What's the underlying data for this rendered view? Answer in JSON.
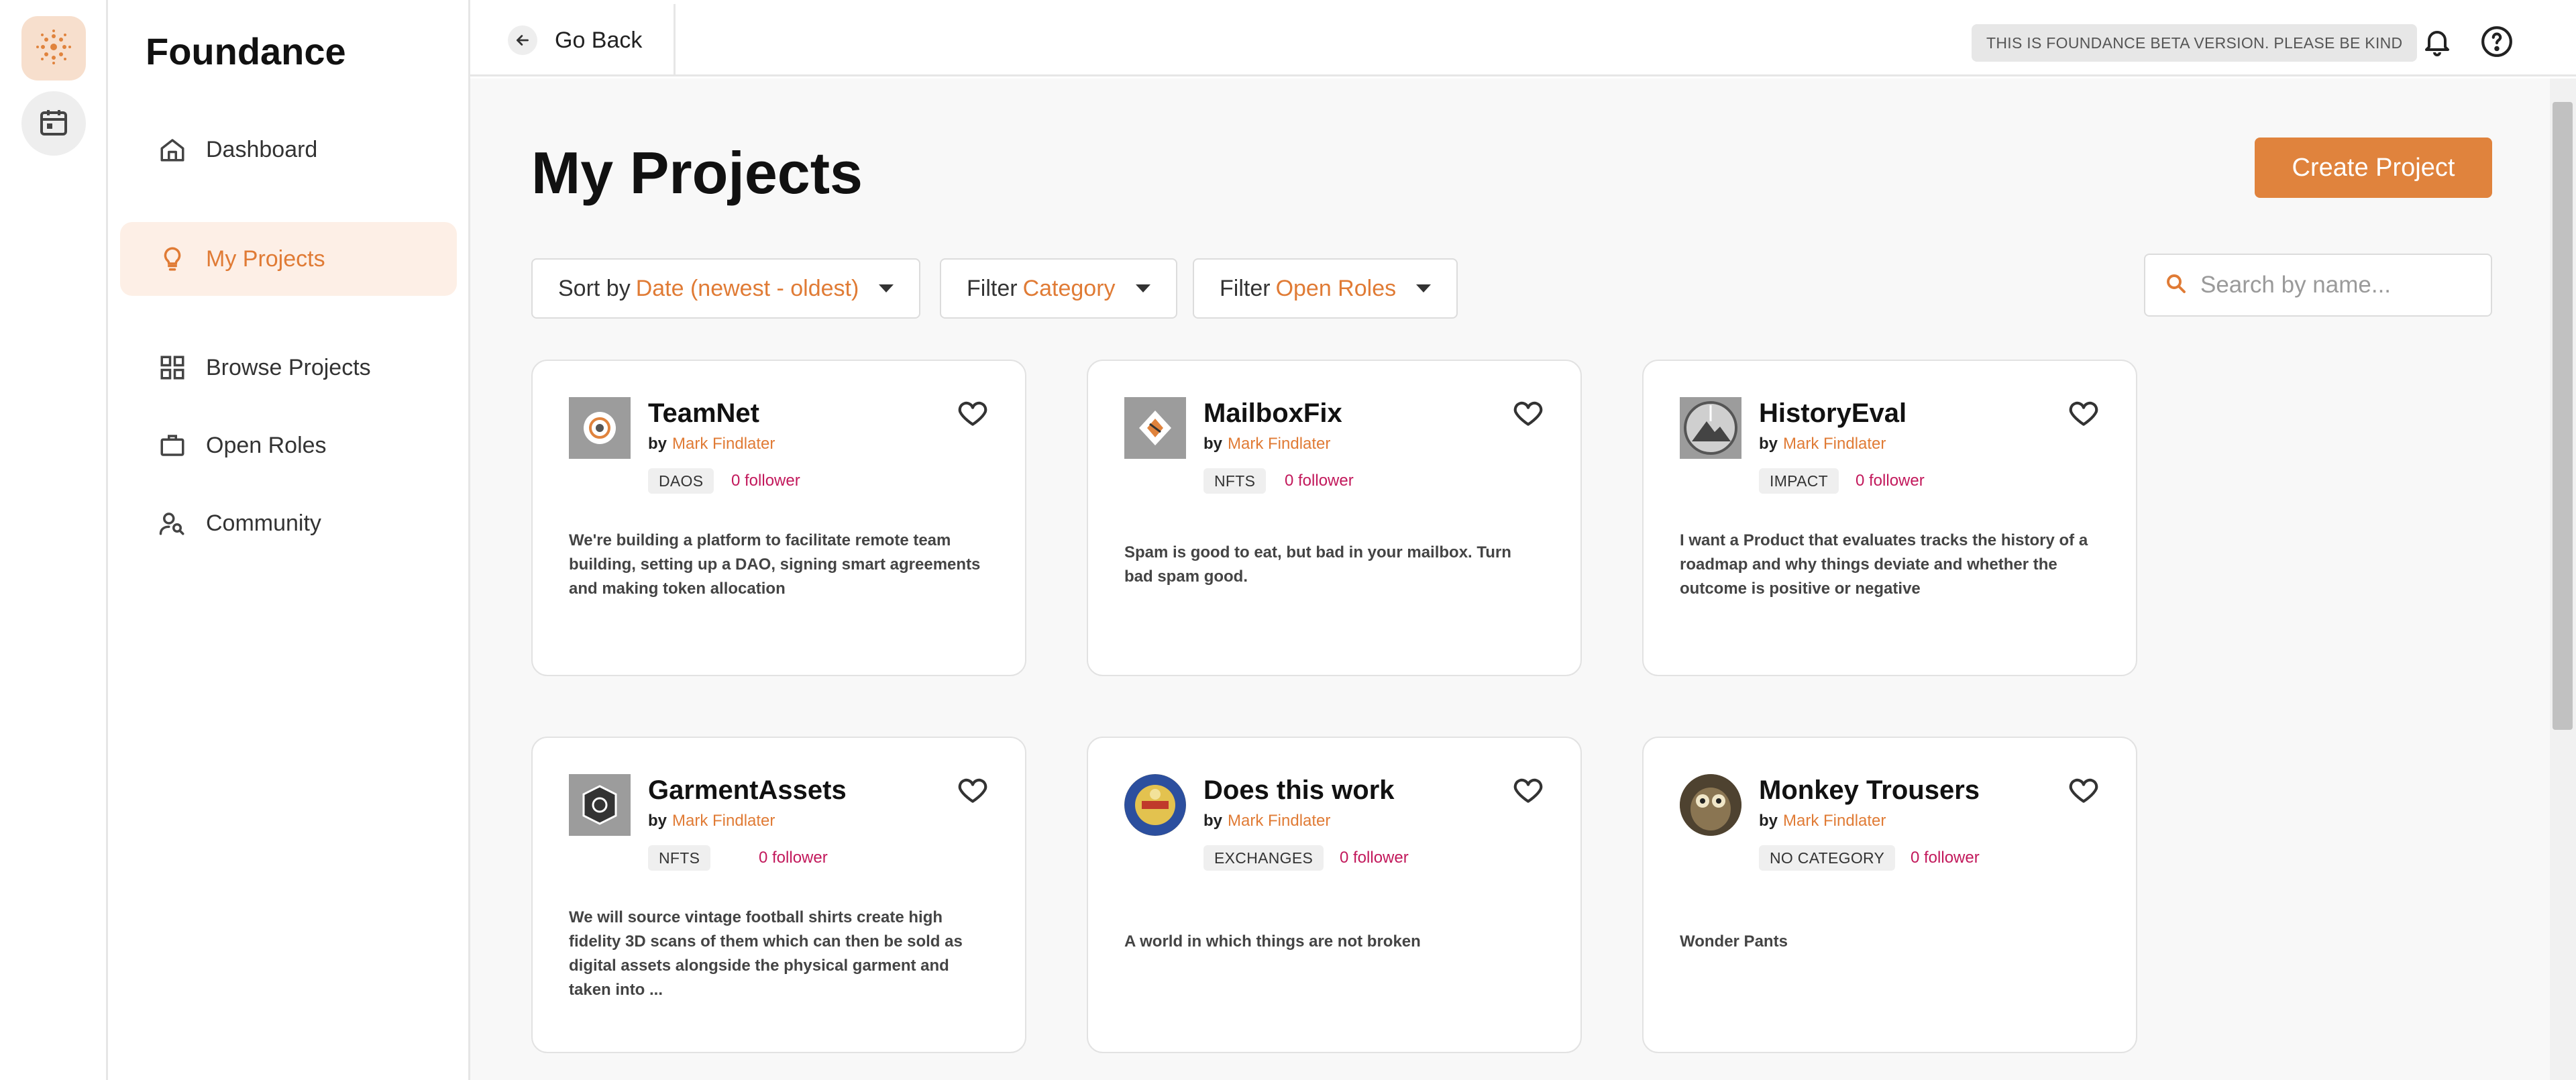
{
  "app": {
    "name": "Foundance"
  },
  "sidebar": {
    "items": [
      {
        "label": "Dashboard",
        "icon": "home-icon"
      },
      {
        "label": "My Projects",
        "icon": "lightbulb-icon",
        "active": true
      },
      {
        "label": "Browse Projects",
        "icon": "grid-icon"
      },
      {
        "label": "Open Roles",
        "icon": "briefcase-icon"
      },
      {
        "label": "Community",
        "icon": "people-search-icon"
      }
    ]
  },
  "topbar": {
    "go_back_label": "Go Back",
    "beta_text": "THIS IS FOUNDANCE BETA VERSION. PLEASE BE KIND"
  },
  "main": {
    "title": "My Projects",
    "create_label": "Create Project",
    "filters": {
      "sort_prefix": "Sort by",
      "sort_value": "Date (newest - oldest)",
      "category_prefix": "Filter",
      "category_value": "Category",
      "roles_prefix": "Filter",
      "roles_value": "Open Roles"
    },
    "search": {
      "placeholder": "Search by name..."
    },
    "projects": [
      {
        "name": "TeamNet",
        "by": "by",
        "author": "Mark Findlater",
        "category": "DAOS",
        "followers": "0 follower",
        "description": "We're building a platform to facilitate remote team building, setting up a DAO, signing smart agreements and making token allocation"
      },
      {
        "name": "MailboxFix",
        "by": "by",
        "author": "Mark Findlater",
        "category": "NFTS",
        "followers": "0 follower",
        "description": "Spam is good to eat, but bad in your mailbox. Turn bad spam good."
      },
      {
        "name": "HistoryEval",
        "by": "by",
        "author": "Mark Findlater",
        "category": "IMPACT",
        "followers": "0 follower",
        "description": "I want a Product that evaluates tracks the history of a roadmap and why things deviate and whether the outcome is positive or negative"
      },
      {
        "name": "GarmentAssets",
        "by": "by",
        "author": "Mark Findlater",
        "category": "NFTS",
        "followers": "0 follower",
        "description": "We will source vintage football shirts create high fidelity 3D scans of them which can then be sold as digital assets alongside the physical garment and taken into ..."
      },
      {
        "name": "Does this work",
        "by": "by",
        "author": "Mark Findlater",
        "category": "EXCHANGES",
        "followers": "0 follower",
        "description": "A world in which things are not broken"
      },
      {
        "name": "Monkey Trousers",
        "by": "by",
        "author": "Mark Findlater",
        "category": "NO CATEGORY",
        "followers": "0 follower",
        "description": "Wonder Pants"
      }
    ]
  },
  "colors": {
    "accent": "#e0833d",
    "accent_text": "#e07b35",
    "follower": "#c2185b",
    "active_bg": "#fdefe6"
  }
}
